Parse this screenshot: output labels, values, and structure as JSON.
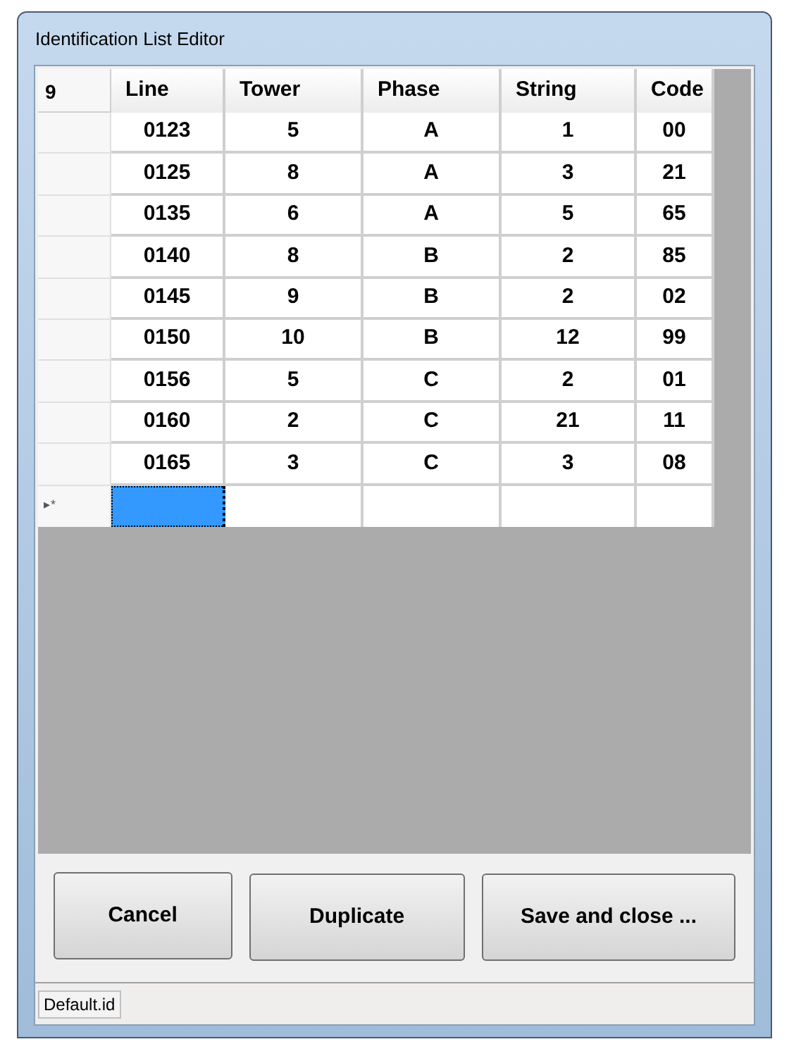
{
  "window": {
    "title": "Identification List Editor"
  },
  "grid": {
    "corner": "9",
    "columns": [
      "Line",
      "Tower",
      "Phase",
      "String",
      "Code"
    ],
    "rows": [
      [
        "0123",
        "5",
        "A",
        "1",
        "00"
      ],
      [
        "0125",
        "8",
        "A",
        "3",
        "21"
      ],
      [
        "0135",
        "6",
        "A",
        "5",
        "65"
      ],
      [
        "0140",
        "8",
        "B",
        "2",
        "85"
      ],
      [
        "0145",
        "9",
        "B",
        "2",
        "02"
      ],
      [
        "0150",
        "10",
        "B",
        "12",
        "99"
      ],
      [
        "0156",
        "5",
        "C",
        "2",
        "01"
      ],
      [
        "0160",
        "2",
        "C",
        "21",
        "11"
      ],
      [
        "0165",
        "3",
        "C",
        "3",
        "08"
      ]
    ],
    "new_row": {
      "marker": "▸*",
      "cells": [
        {
          "selected": true
        },
        {
          "selected": false
        },
        {
          "selected": false
        },
        {
          "selected": false
        },
        {
          "selected": false
        }
      ]
    }
  },
  "buttons": [
    "Cancel",
    "Duplicate",
    "Save and close ..."
  ],
  "status_bar": {
    "file": "Default.id"
  }
}
